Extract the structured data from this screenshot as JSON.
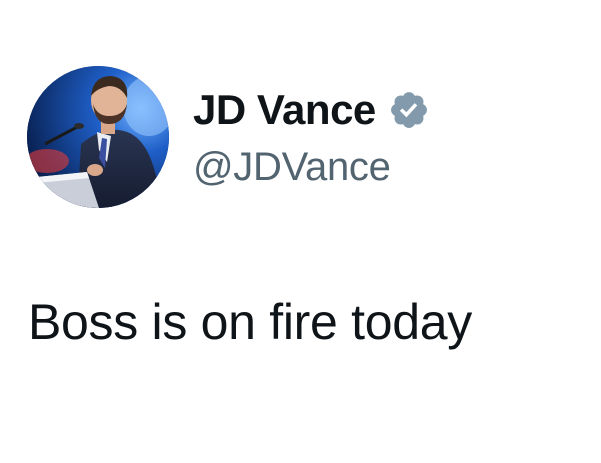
{
  "tweet": {
    "author": {
      "display_name": "JD Vance",
      "handle": "@JDVance",
      "verified": true,
      "verified_badge_color": "#829aab"
    },
    "text": "Boss is on fire today"
  },
  "icons": {
    "top": "chevron-down-icon",
    "badge": "verified-badge-icon"
  },
  "colors": {
    "text_primary": "#0f1419",
    "text_secondary": "#536471",
    "background": "#ffffff"
  }
}
